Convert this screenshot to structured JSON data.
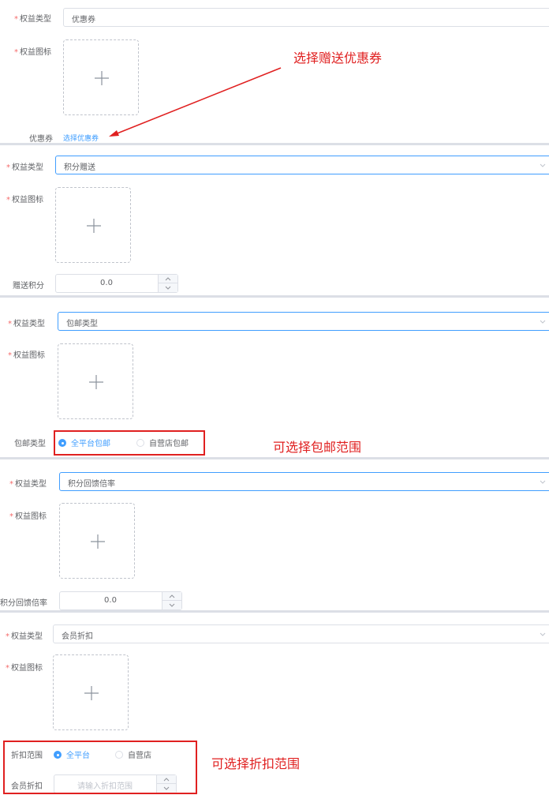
{
  "common": {
    "req": "*",
    "type_label": "权益类型",
    "icon_label": "权益图标"
  },
  "panels": {
    "coupon": {
      "type_value": "优惠券",
      "coupon_label": "优惠券",
      "select_link": "选择优惠券",
      "annotation": "选择赠送优惠券"
    },
    "points": {
      "type_value": "积分赠送",
      "gift_label": "赠送积分",
      "gift_value": "0.0"
    },
    "shipping": {
      "type_value": "包邮类型",
      "ship_label": "包邮类型",
      "options": [
        "全平台包邮",
        "自营店包邮"
      ],
      "selected": "全平台包邮",
      "annotation": "可选择包邮范围"
    },
    "rebate": {
      "type_value": "积分回馈倍率",
      "rate_label": "积分回馈倍率",
      "rate_value": "0.0"
    },
    "discount": {
      "type_value": "会员折扣",
      "scope_label": "折扣范围",
      "options": [
        "全平台",
        "自营店"
      ],
      "selected": "全平台",
      "member_label": "会员折扣",
      "member_placeholder": "请输入折扣范围",
      "annotation": "可选择折扣范围"
    }
  },
  "colors": {
    "accent": "#409eff",
    "required": "#f56c6c",
    "annotation": "#e02020",
    "border": "#dcdfe6"
  },
  "icons": {
    "upload": "plus-icon",
    "select": "chevron-down-icon",
    "stepper": "arrow-up-down-icon"
  }
}
